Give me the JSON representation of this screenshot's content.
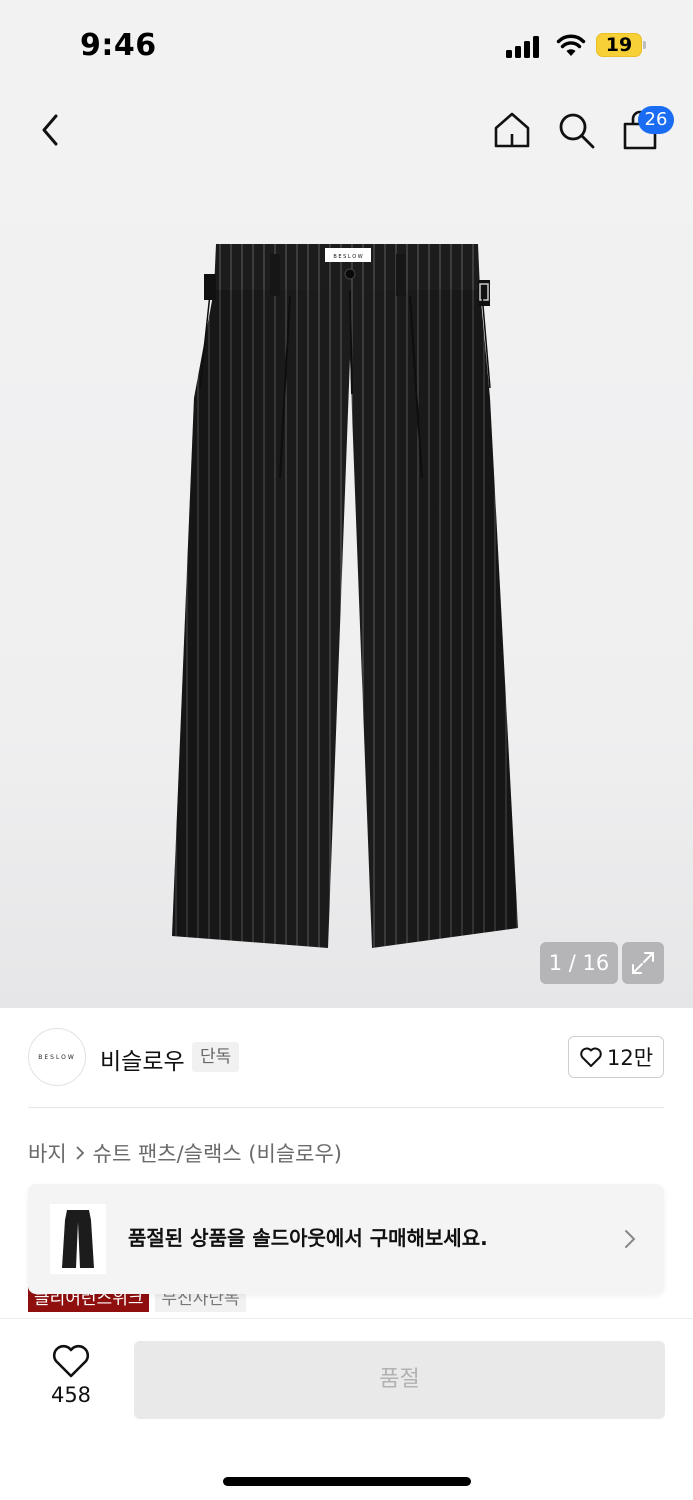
{
  "status_bar": {
    "time": "9:46",
    "battery": "19",
    "icons": [
      "signal-icon",
      "wifi-icon",
      "battery-icon"
    ]
  },
  "header": {
    "icons": [
      "back-arrow-icon",
      "home-icon",
      "search-icon",
      "shopping-bag-icon"
    ],
    "cart_count": "26"
  },
  "gallery": {
    "counter": "1 / 16",
    "expand_icon": "expand-icon"
  },
  "brand": {
    "logo_text": "BESLOW",
    "name": "비슬로우",
    "tag": "단독",
    "like_count": "12만"
  },
  "breadcrumb": {
    "category": "바지",
    "subcategory": "슈트 팬츠/슬랙스 (비슬로우)"
  },
  "labels": {
    "red": "클리어런스위크",
    "gray": "무신사단독"
  },
  "banner": {
    "text": "품절된 상품을 솔드아웃에서 구매해보세요."
  },
  "bottom_bar": {
    "wish_count": "458",
    "primary_button": "품절"
  },
  "colors": {
    "accent_badge": "#1a6cf2",
    "label_red": "#8f0e0e",
    "battery": "#f7cf37"
  }
}
